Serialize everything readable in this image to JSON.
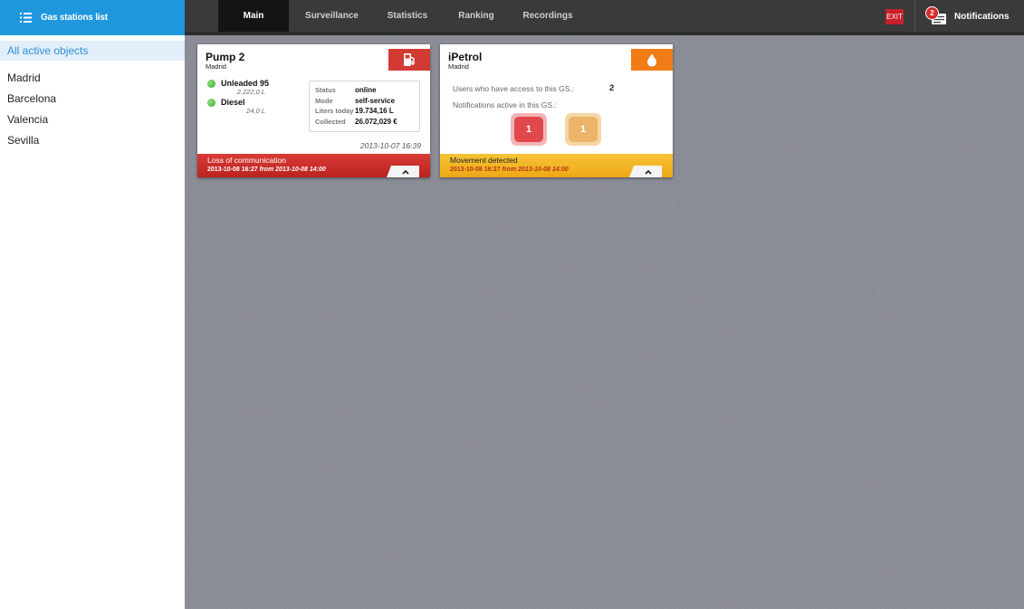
{
  "sidebar": {
    "header_title": "Gas stations list",
    "items": [
      {
        "label": "All active objects"
      },
      {
        "label": "Madrid"
      },
      {
        "label": "Barcelona"
      },
      {
        "label": "Valencia"
      },
      {
        "label": "Sevilla"
      }
    ]
  },
  "nav": {
    "tabs": [
      {
        "label": "Main"
      },
      {
        "label": "Surveillance"
      },
      {
        "label": "Statistics"
      },
      {
        "label": "Ranking"
      },
      {
        "label": "Recordings"
      }
    ],
    "exit_label": "EXIT",
    "notifications_label": "Notifications",
    "notifications_count": "2"
  },
  "cards": [
    {
      "title": "Pump 2",
      "city": "Madrid",
      "icon": "fuel-pump-icon",
      "fuels": [
        {
          "name": "Unleaded 95",
          "amount": "2.222,0 L"
        },
        {
          "name": "Diesel",
          "amount": "24,0 L"
        }
      ],
      "info": {
        "status_label": "Status",
        "status_value": "online",
        "mode_label": "Mode",
        "mode_value": "self-service",
        "liters_label": "Liters today",
        "liters_value": "19.734,16 L",
        "collected_label": "Collected",
        "collected_value": "26.072,029 €"
      },
      "date": "2013-10-07 16:39",
      "footer_title": "Loss of communication",
      "footer_time": "2013-10-08 16:27",
      "footer_from": "from 2013-10-08 14:00"
    },
    {
      "title": "iPetrol",
      "city": "Madrid",
      "icon": "oil-drop-icon",
      "users_label": "Users who have access to this GS.:",
      "users_count": "2",
      "notifs_label": "Notifications active in this GS.:",
      "notif_red_count": "1",
      "notif_orange_count": "1",
      "footer_title": "Movement detected",
      "footer_time": "2013-10-08 16:27",
      "footer_from": "from 2013-10-08 14:00"
    }
  ],
  "colors": {
    "accent_blue": "#1f97dc",
    "alarm_red": "#d23a33",
    "warning_orange": "#f07c17",
    "warning_yellow": "#f2b424"
  }
}
